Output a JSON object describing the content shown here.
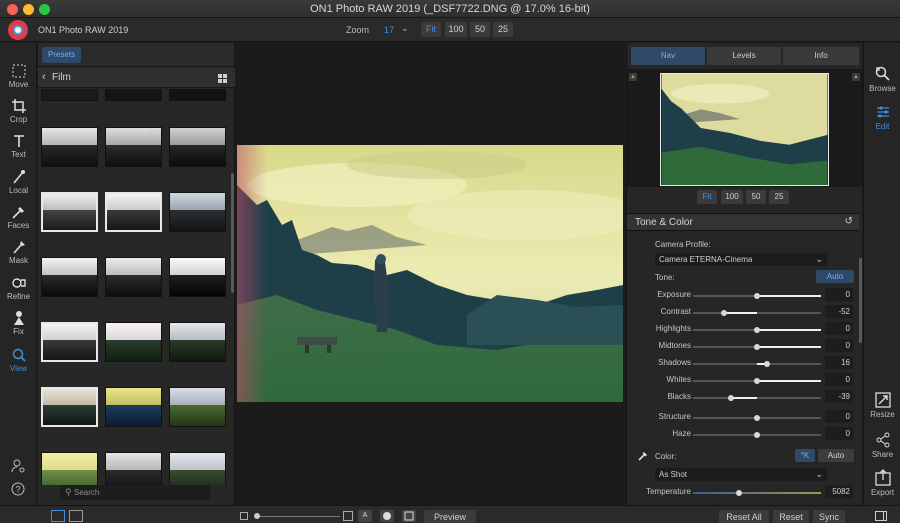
{
  "window": {
    "title": "ON1 Photo RAW 2019 (_DSF7722.DNG @ 17.0% 16-bit)"
  },
  "toolbar": {
    "app_name": "ON1 Photo RAW 2019",
    "zoom_label": "Zoom",
    "zoom_value": "17",
    "zoom_chevron": "⌄",
    "zoom_buttons": [
      "Fit",
      "100",
      "50",
      "25"
    ],
    "active_zoom": "Fit"
  },
  "left_tools": [
    {
      "label": "Move",
      "icon": "move-icon"
    },
    {
      "label": "Crop",
      "icon": "crop-icon"
    },
    {
      "label": "Text",
      "icon": "text-icon"
    },
    {
      "label": "Local",
      "icon": "brush-icon"
    },
    {
      "label": "Faces",
      "icon": "faces-icon"
    },
    {
      "label": "Mask",
      "icon": "mask-icon"
    },
    {
      "label": "Refine",
      "icon": "refine-icon"
    },
    {
      "label": "Fix",
      "icon": "fix-icon"
    },
    {
      "label": "View",
      "icon": "view-icon"
    }
  ],
  "presets": {
    "tab": "Presets",
    "category": "Film",
    "search_placeholder": "Search"
  },
  "nav": {
    "tabs": [
      "Nav",
      "Levels",
      "Info"
    ],
    "active_tab": "Nav",
    "zoom_buttons": [
      "Fit",
      "100",
      "50",
      "25"
    ],
    "active_zoom": "Fit"
  },
  "tone_color": {
    "title": "Tone & Color",
    "camera_profile_label": "Camera Profile:",
    "camera_profile_value": "Camera ETERNA-Cinema",
    "tone_label": "Tone:",
    "auto_label": "Auto",
    "sliders": [
      {
        "name": "Exposure",
        "value": "0",
        "pos": 0.5
      },
      {
        "name": "Contrast",
        "value": "-52",
        "pos": 0.24
      },
      {
        "name": "Highlights",
        "value": "0",
        "pos": 0.5
      },
      {
        "name": "Midtones",
        "value": "0",
        "pos": 0.5
      },
      {
        "name": "Shadows",
        "value": "16",
        "pos": 0.58
      },
      {
        "name": "Whites",
        "value": "0",
        "pos": 0.5
      },
      {
        "name": "Blacks",
        "value": "-39",
        "pos": 0.3
      },
      {
        "name": "Structure",
        "value": "0",
        "pos": 0.5
      },
      {
        "name": "Haze",
        "value": "0",
        "pos": 0.5
      }
    ],
    "color_label": "Color:",
    "kelvin_label": "°K",
    "color_auto_label": "Auto",
    "white_balance_value": "As Shot",
    "temperature_label": "Temperature",
    "temperature_value": "5082",
    "temperature_pos": 0.36
  },
  "right_tools": [
    {
      "label": "Browse",
      "icon": "browse-icon"
    },
    {
      "label": "Edit",
      "icon": "edit-icon"
    },
    {
      "label": "Resize",
      "icon": "resize-icon"
    },
    {
      "label": "Share",
      "icon": "share-icon"
    },
    {
      "label": "Export",
      "icon": "export-icon"
    }
  ],
  "bottom": {
    "preview_label": "Preview",
    "reset_all_label": "Reset All",
    "reset_label": "Reset",
    "sync_label": "Sync",
    "text_mode_label": "A"
  },
  "colors": {
    "accent": "#3f8fe0",
    "tab_active_bg": "#2f4966"
  }
}
